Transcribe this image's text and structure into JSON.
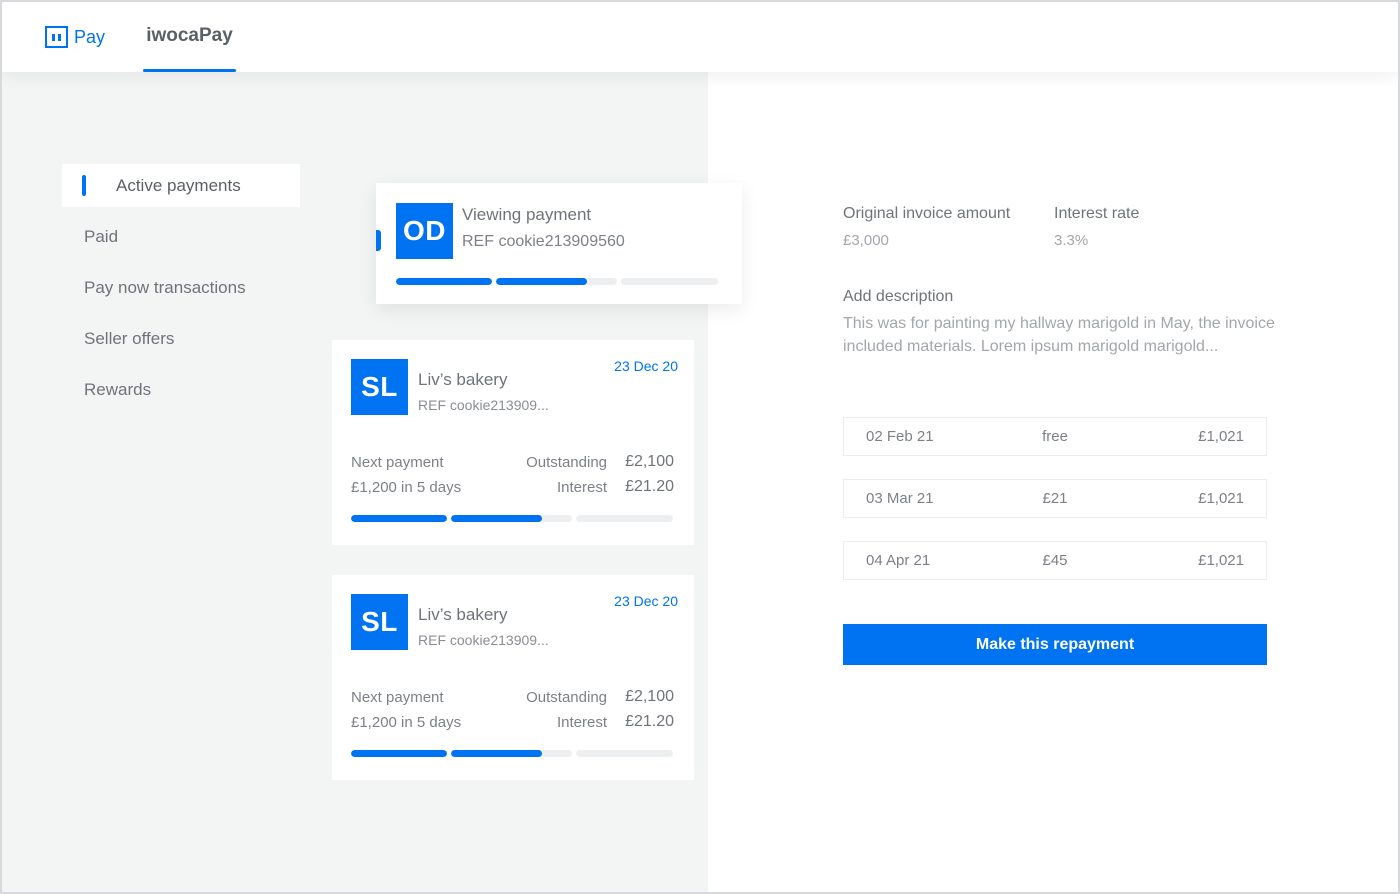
{
  "header": {
    "logo_text": "Pay",
    "active_tab": "iwocaPay"
  },
  "sidebar": {
    "items": [
      {
        "label": "Active payments",
        "active": true
      },
      {
        "label": "Paid"
      },
      {
        "label": "Pay now transactions"
      },
      {
        "label": "Seller offers"
      },
      {
        "label": "Rewards"
      }
    ]
  },
  "viewing_card": {
    "avatar": "OD",
    "title": "Viewing payment",
    "ref": "REF cookie213909560",
    "progress": [
      1,
      0.75,
      0
    ]
  },
  "payment_cards": [
    {
      "avatar": "SL",
      "name": "Liv’s bakery",
      "ref": "REF cookie213909...",
      "date": "23 Dec 20",
      "next_payment_label": "Next payment",
      "next_payment_value": "£1,200 in 5 days",
      "outstanding_label": "Outstanding",
      "outstanding_value": "£2,100",
      "interest_label": "Interest",
      "interest_value": "£21.20",
      "progress": [
        1,
        0.75,
        0
      ]
    },
    {
      "avatar": "SL",
      "name": "Liv’s bakery",
      "ref": "REF cookie213909...",
      "date": "23 Dec 20",
      "next_payment_label": "Next payment",
      "next_payment_value": "£1,200 in 5 days",
      "outstanding_label": "Outstanding",
      "outstanding_value": "£2,100",
      "interest_label": "Interest",
      "interest_value": "£21.20",
      "progress": [
        1,
        0.75,
        0
      ]
    }
  ],
  "detail": {
    "invoice_label": "Original invoice amount",
    "invoice_value": "£3,000",
    "rate_label": "Interest rate",
    "rate_value": "3.3%",
    "description_label": "Add description",
    "description_text": "This was for painting my hallway marigold in May, the invoice included materials. Lorem ipsum marigold marigold...",
    "schedule": [
      {
        "date": "02 Feb 21",
        "fee": "free",
        "amount": "£1,021"
      },
      {
        "date": "03 Mar 21",
        "fee": "£21",
        "amount": "£1,021"
      },
      {
        "date": "04 Apr 21",
        "fee": "£45",
        "amount": "£1,021"
      }
    ],
    "button_label": "Make this repayment"
  },
  "colors": {
    "accent": "#0073f2",
    "panel_bg": "#f3f4f4"
  }
}
